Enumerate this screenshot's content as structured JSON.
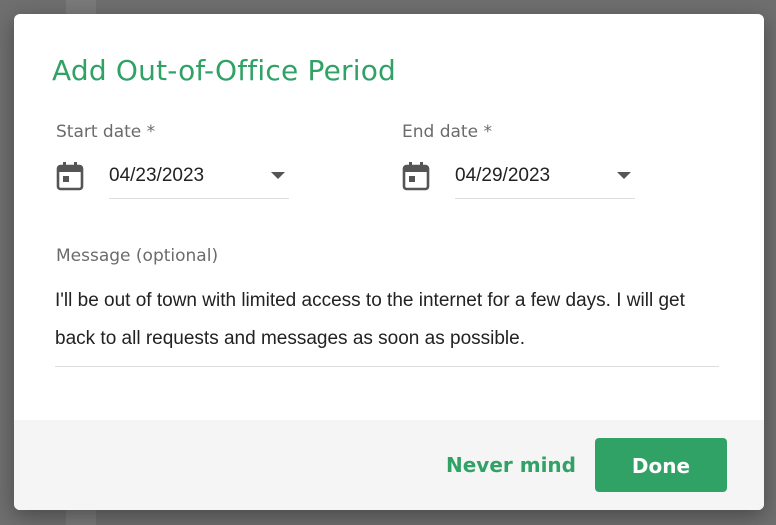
{
  "dialog": {
    "title": "Add Out-of-Office Period",
    "start_date": {
      "label": "Start date *",
      "value": "04/23/2023",
      "icon": "calendar-icon"
    },
    "end_date": {
      "label": "End date *",
      "value": "04/29/2023",
      "icon": "calendar-icon"
    },
    "message": {
      "label": "Message (optional)",
      "value": "I'll be out of town with limited access to the internet for a few days. I will get back to all requests and messages as soon as possible."
    },
    "buttons": {
      "cancel_label": "Never mind",
      "done_label": "Done"
    }
  },
  "colors": {
    "accent": "#31a266",
    "footer_bg": "#f5f5f5",
    "icon": "#555555"
  }
}
